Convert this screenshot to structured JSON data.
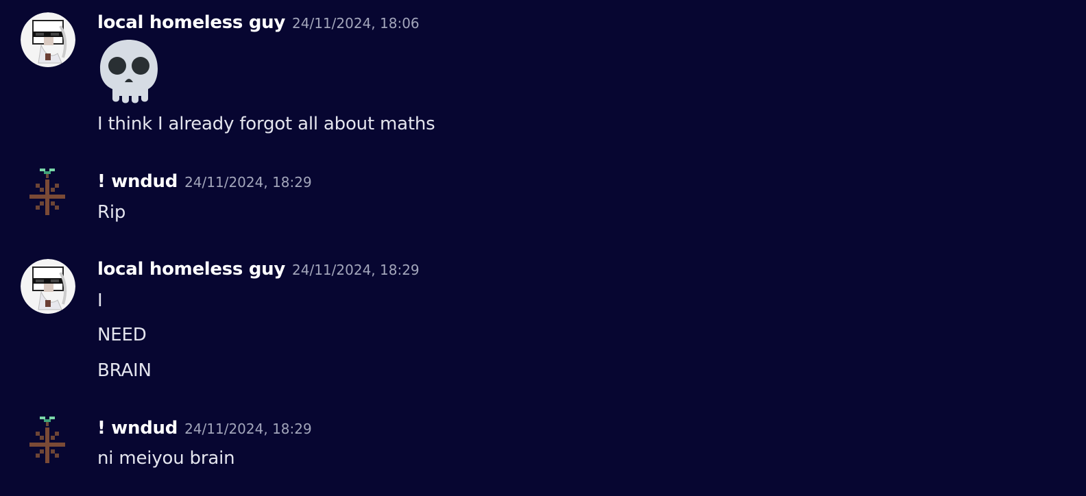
{
  "messages": [
    {
      "author": "local homeless guy",
      "timestamp": "24/11/2024, 18:06",
      "avatar_icon": "sunglasses-avatar-icon",
      "emoji": "skull-emoji",
      "lines": [
        "I think I already forgot all about maths"
      ]
    },
    {
      "author": "! wndud",
      "timestamp": "24/11/2024, 18:29",
      "avatar_icon": "sprout-pixel-avatar-icon",
      "lines": [
        "Rip"
      ]
    },
    {
      "author": "local homeless guy",
      "timestamp": "24/11/2024, 18:29",
      "avatar_icon": "sunglasses-avatar-icon",
      "lines": [
        "I",
        "NEED",
        "BRAIN"
      ]
    },
    {
      "author": "! wndud",
      "timestamp": "24/11/2024, 18:29",
      "avatar_icon": "sprout-pixel-avatar-icon",
      "lines": [
        "ni meiyou brain"
      ]
    }
  ],
  "colors": {
    "background": "#070631",
    "username": "#ffffff",
    "timestamp": "#a3a6bb",
    "text": "#e4e5ee"
  }
}
